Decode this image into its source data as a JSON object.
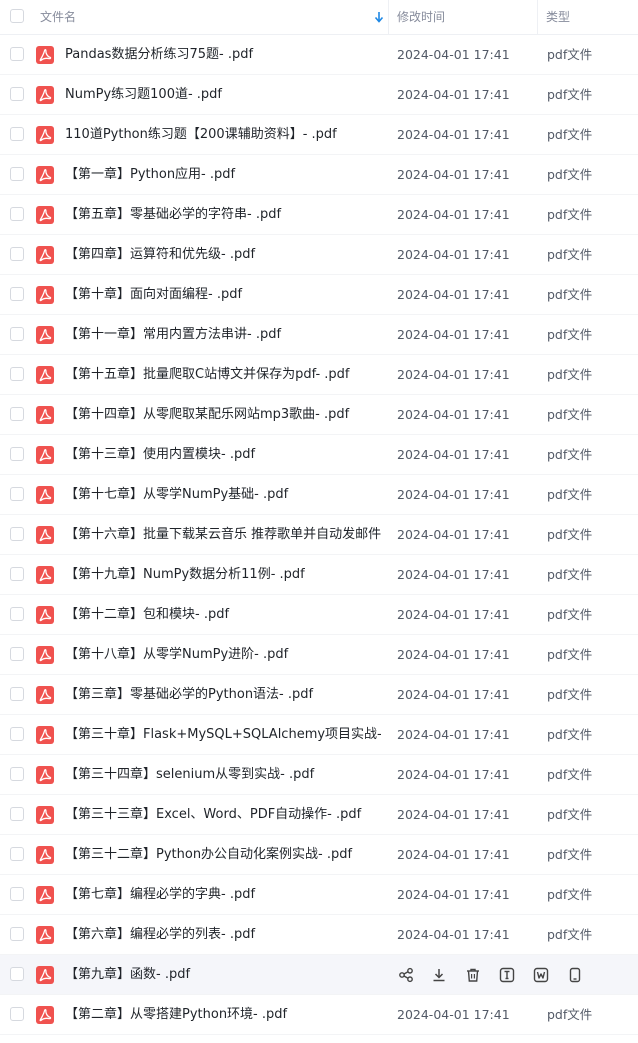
{
  "header": {
    "name_label": "文件名",
    "date_label": "修改时间",
    "type_label": "类型",
    "sort_icon": "sort-arrow-down-icon"
  },
  "colors": {
    "pdf_red": "#f0524f",
    "sort_blue": "#1e88e5",
    "hover_bg": "#f5f6fa"
  },
  "hover_row_index": 23,
  "row_actions": [
    "share-icon",
    "download-icon",
    "delete-icon",
    "rename-icon",
    "save-to-netdisk-icon",
    "send-to-phone-icon"
  ],
  "files": [
    {
      "name": "Pandas数据分析练习75题- .pdf",
      "date": "2024-04-01 17:41",
      "type": "pdf文件"
    },
    {
      "name": "NumPy练习题100道- .pdf",
      "date": "2024-04-01 17:41",
      "type": "pdf文件"
    },
    {
      "name": "110道Python练习题【200课辅助资料】- .pdf",
      "date": "2024-04-01 17:41",
      "type": "pdf文件"
    },
    {
      "name": "【第一章】Python应用- .pdf",
      "date": "2024-04-01 17:41",
      "type": "pdf文件"
    },
    {
      "name": "【第五章】零基础必学的字符串- .pdf",
      "date": "2024-04-01 17:41",
      "type": "pdf文件"
    },
    {
      "name": "【第四章】运算符和优先级- .pdf",
      "date": "2024-04-01 17:41",
      "type": "pdf文件"
    },
    {
      "name": "【第十章】面向对面编程- .pdf",
      "date": "2024-04-01 17:41",
      "type": "pdf文件"
    },
    {
      "name": "【第十一章】常用内置方法串讲- .pdf",
      "date": "2024-04-01 17:41",
      "type": "pdf文件"
    },
    {
      "name": "【第十五章】批量爬取C站博文并保存为pdf- .pdf",
      "date": "2024-04-01 17:41",
      "type": "pdf文件"
    },
    {
      "name": "【第十四章】从零爬取某配乐网站mp3歌曲- .pdf",
      "date": "2024-04-01 17:41",
      "type": "pdf文件"
    },
    {
      "name": "【第十三章】使用内置模块- .pdf",
      "date": "2024-04-01 17:41",
      "type": "pdf文件"
    },
    {
      "name": "【第十七章】从零学NumPy基础- .pdf",
      "date": "2024-04-01 17:41",
      "type": "pdf文件"
    },
    {
      "name": "【第十六章】批量下载某云音乐 推荐歌单并自动发邮件- ....",
      "date": "2024-04-01 17:41",
      "type": "pdf文件"
    },
    {
      "name": "【第十九章】NumPy数据分析11例- .pdf",
      "date": "2024-04-01 17:41",
      "type": "pdf文件"
    },
    {
      "name": "【第十二章】包和模块- .pdf",
      "date": "2024-04-01 17:41",
      "type": "pdf文件"
    },
    {
      "name": "【第十八章】从零学NumPy进阶- .pdf",
      "date": "2024-04-01 17:41",
      "type": "pdf文件"
    },
    {
      "name": "【第三章】零基础必学的Python语法- .pdf",
      "date": "2024-04-01 17:41",
      "type": "pdf文件"
    },
    {
      "name": "【第三十章】Flask+MySQL+SQLAlchemy项目实战- .pdf",
      "date": "2024-04-01 17:41",
      "type": "pdf文件"
    },
    {
      "name": "【第三十四章】selenium从零到实战- .pdf",
      "date": "2024-04-01 17:41",
      "type": "pdf文件"
    },
    {
      "name": "【第三十三章】Excel、Word、PDF自动操作- .pdf",
      "date": "2024-04-01 17:41",
      "type": "pdf文件"
    },
    {
      "name": "【第三十二章】Python办公自动化案例实战- .pdf",
      "date": "2024-04-01 17:41",
      "type": "pdf文件"
    },
    {
      "name": "【第七章】编程必学的字典- .pdf",
      "date": "2024-04-01 17:41",
      "type": "pdf文件"
    },
    {
      "name": "【第六章】编程必学的列表- .pdf",
      "date": "2024-04-01 17:41",
      "type": "pdf文件"
    },
    {
      "name": "【第九章】函数- .pdf",
      "date": "",
      "type": ""
    },
    {
      "name": "【第二章】从零搭建Python环境- .pdf",
      "date": "2024-04-01 17:41",
      "type": "pdf文件"
    }
  ]
}
